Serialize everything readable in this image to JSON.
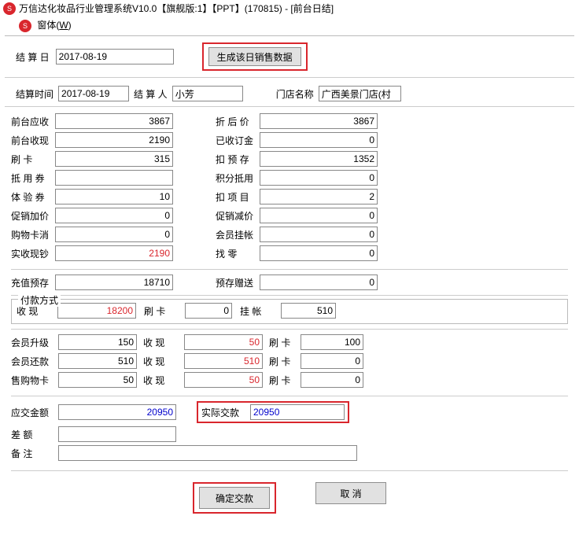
{
  "window": {
    "title": "万信达化妆品行业管理系统V10.0【旗舰版:1】【PPT】(170815) - [前台日结]",
    "menu_window": "窗体(W)"
  },
  "top": {
    "date_label": "结 算 日",
    "date_value": "2017-08-19",
    "gen_button": "生成该日销售数据"
  },
  "info": {
    "time_label": "结算时间",
    "time_value": "2017-08-19",
    "person_label": "结 算 人",
    "person_value": "小芳",
    "store_label": "门店名称",
    "store_value": "广西美景门店(村"
  },
  "grid": {
    "l1": {
      "label": "前台应收",
      "value": "3867"
    },
    "r1": {
      "label": "折 后 价",
      "value": "3867"
    },
    "l2": {
      "label": "前台收现",
      "value": "2190"
    },
    "r2": {
      "label": "已收订金",
      "value": "0"
    },
    "l3": {
      "label": "刷   卡",
      "value": "315"
    },
    "r3": {
      "label": "扣 预 存",
      "value": "1352"
    },
    "l4": {
      "label": "抵 用 券",
      "value": ""
    },
    "r4": {
      "label": "积分抵用",
      "value": "0"
    },
    "l5": {
      "label": "体 验 券",
      "value": "10"
    },
    "r5": {
      "label": "扣 项 目",
      "value": "2"
    },
    "l6": {
      "label": "促销加价",
      "value": "0"
    },
    "r6": {
      "label": "促销减价",
      "value": "0"
    },
    "l7": {
      "label": "购物卡消",
      "value": "0"
    },
    "r7": {
      "label": "会员挂帐",
      "value": "0"
    },
    "l8": {
      "label": "实收现钞",
      "value": "2190"
    },
    "r8": {
      "label": "找   零",
      "value": "0"
    }
  },
  "recharge": {
    "l": {
      "label": "充值预存",
      "value": "18710"
    },
    "r": {
      "label": "预存赠送",
      "value": "0"
    }
  },
  "payment": {
    "legend": "付款方式",
    "cash_label": "收   现",
    "cash_value": "18200",
    "card_label": "刷   卡",
    "card_value": "0",
    "credit_label": "挂   帐",
    "credit_value": "510"
  },
  "triple": {
    "row1": {
      "l_label": "会员升级",
      "l_value": "150",
      "m_label": "收   现",
      "m_value": "50",
      "r_label": "刷 卡",
      "r_value": "100"
    },
    "row2": {
      "l_label": "会员还款",
      "l_value": "510",
      "m_label": "收   现",
      "m_value": "510",
      "r_label": "刷 卡",
      "r_value": "0"
    },
    "row3": {
      "l_label": "售购物卡",
      "l_value": "50",
      "m_label": "收   现",
      "m_value": "50",
      "r_label": "刷 卡",
      "r_value": "0"
    }
  },
  "totals": {
    "due_label": "应交金额",
    "due_value": "20950",
    "actual_label": "实际交款",
    "actual_value": "20950",
    "diff_label": "差   额",
    "diff_value": "",
    "note_label": "备   注",
    "note_value": ""
  },
  "buttons": {
    "confirm": "确定交款",
    "cancel": "取   消"
  }
}
